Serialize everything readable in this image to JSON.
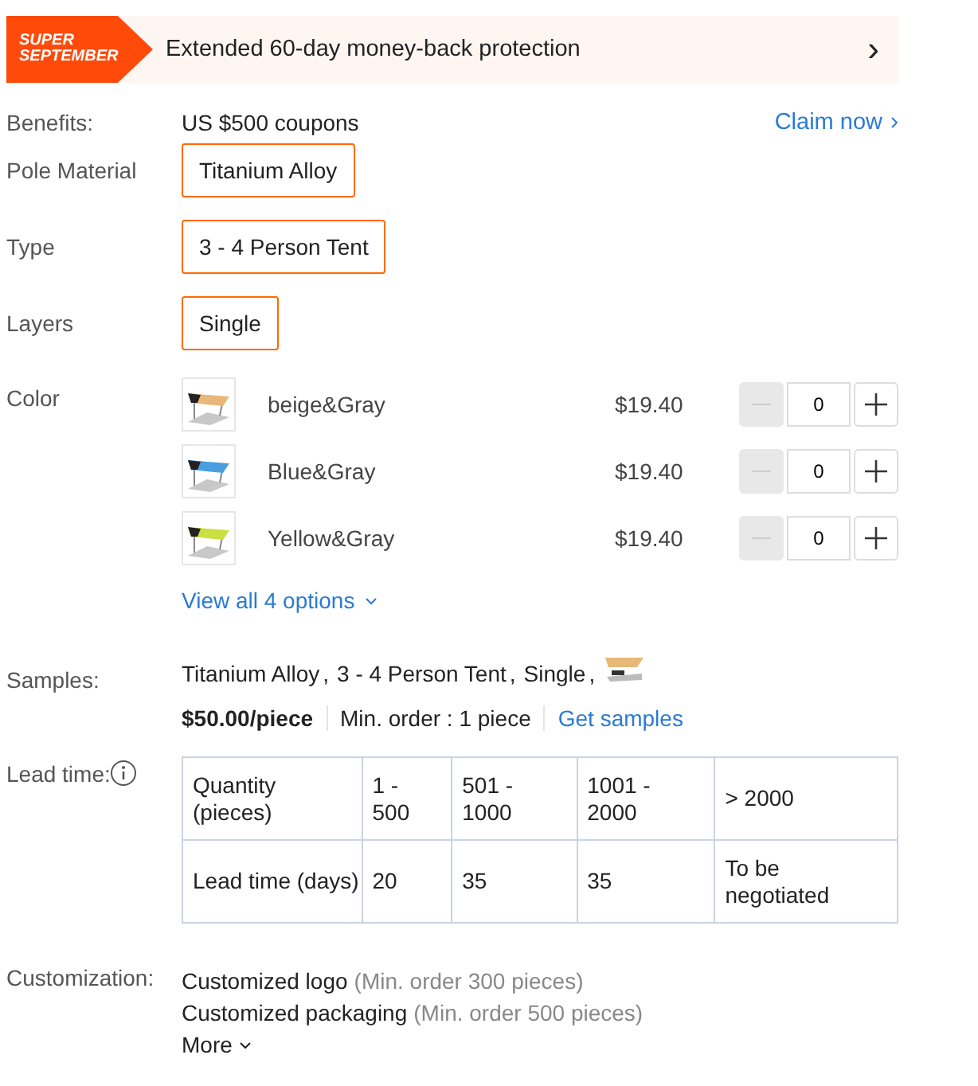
{
  "promo_banner": {
    "badge": "SUPER\nSEPTEMBER",
    "text": "Extended 60-day money-back protection",
    "arrow": "›"
  },
  "benefits": {
    "label": "Benefits:",
    "value": "US $500 coupons",
    "link": "Claim now"
  },
  "attributes": [
    {
      "label": "Pole Material",
      "options": [
        {
          "label": "Titanium Alloy",
          "selected": true
        }
      ]
    },
    {
      "label": "Type",
      "options": [
        {
          "label": "3 - 4 Person Tent",
          "selected": true
        }
      ]
    },
    {
      "label": "Layers",
      "options": [
        {
          "label": "Single",
          "selected": true
        }
      ]
    }
  ],
  "color": {
    "label": "Color",
    "variants": [
      {
        "name": "beige&Gray",
        "price": "$19.40",
        "quantity": "0",
        "color": "#e8b878",
        "minus_disabled": true
      },
      {
        "name": "Blue&Gray",
        "price": "$19.40",
        "quantity": "0",
        "color": "#4a9ee0",
        "minus_disabled": true
      },
      {
        "name": "Yellow&Gray",
        "price": "$19.40",
        "quantity": "0",
        "color": "#c8e040",
        "minus_disabled": true
      }
    ],
    "view_all": "View all 4 options"
  },
  "samples": {
    "label": "Samples:",
    "selection": [
      "Titanium Alloy",
      "3 - 4 Person Tent",
      "Single"
    ],
    "separator": ",",
    "price": "$50.00/piece",
    "min_order": "Min. order : 1 piece",
    "link": "Get samples"
  },
  "lead_time": {
    "label": "Lead time:",
    "table": {
      "rows": [
        [
          "Quantity (pieces)",
          "1 - 500",
          "501 - 1000",
          "1001 - 2000",
          "> 2000"
        ],
        [
          "Lead time (days)",
          "20",
          "35",
          "35",
          "To be negotiated"
        ]
      ]
    }
  },
  "customization": {
    "label": "Customization:",
    "items": [
      {
        "name": "Customized logo",
        "note": "(Min. order 300 pieces)"
      },
      {
        "name": "Customized packaging",
        "note": "(Min. order 500 pieces)"
      }
    ],
    "more": "More"
  }
}
